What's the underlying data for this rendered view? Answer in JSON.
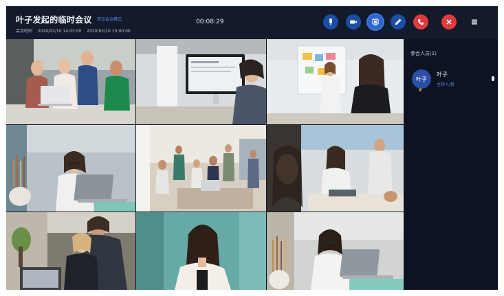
{
  "header": {
    "title": "叶子发起的临时会议",
    "mode_badge": "审议会议模式",
    "meta_label": "会议时间",
    "start_time": "2020/02/10 14:03:00",
    "end_time": "2020/02/10 15:00:00",
    "timer": "00:08:29"
  },
  "controls": [
    {
      "name": "microphone",
      "icon": "mic-icon"
    },
    {
      "name": "camera",
      "icon": "video-camera-icon"
    },
    {
      "name": "screen-share",
      "icon": "share-screen-icon"
    },
    {
      "name": "annotate",
      "icon": "pen-icon"
    },
    {
      "name": "hang-up",
      "icon": "phone-hangup-icon",
      "color": "#e0393e"
    },
    {
      "name": "end-meeting",
      "icon": "close-icon",
      "color": "#e0393e"
    },
    {
      "name": "menu",
      "icon": "menu-icon"
    }
  ],
  "participants_panel": {
    "title": "参会人员(1)",
    "participants": [
      {
        "avatar_text": "叶子",
        "name": "叶子",
        "role": "主持人/我",
        "host": true
      }
    ]
  },
  "video_tiles": [
    {
      "id": 1,
      "scene": "four people around laptop"
    },
    {
      "id": 2,
      "scene": "person at monitor"
    },
    {
      "id": 3,
      "scene": "two women at whiteboard"
    },
    {
      "id": 4,
      "scene": "woman at laptop with pencils"
    },
    {
      "id": 5,
      "scene": "group in office"
    },
    {
      "id": 6,
      "scene": "women in office"
    },
    {
      "id": 7,
      "scene": "two people at desk"
    },
    {
      "id": 8,
      "scene": "woman smiling"
    },
    {
      "id": 9,
      "scene": "woman with laptop"
    }
  ],
  "colors": {
    "app_background": "#0f1522",
    "accent": "#2e66cc",
    "danger": "#e0393e",
    "host_crown": "#f2c230"
  }
}
